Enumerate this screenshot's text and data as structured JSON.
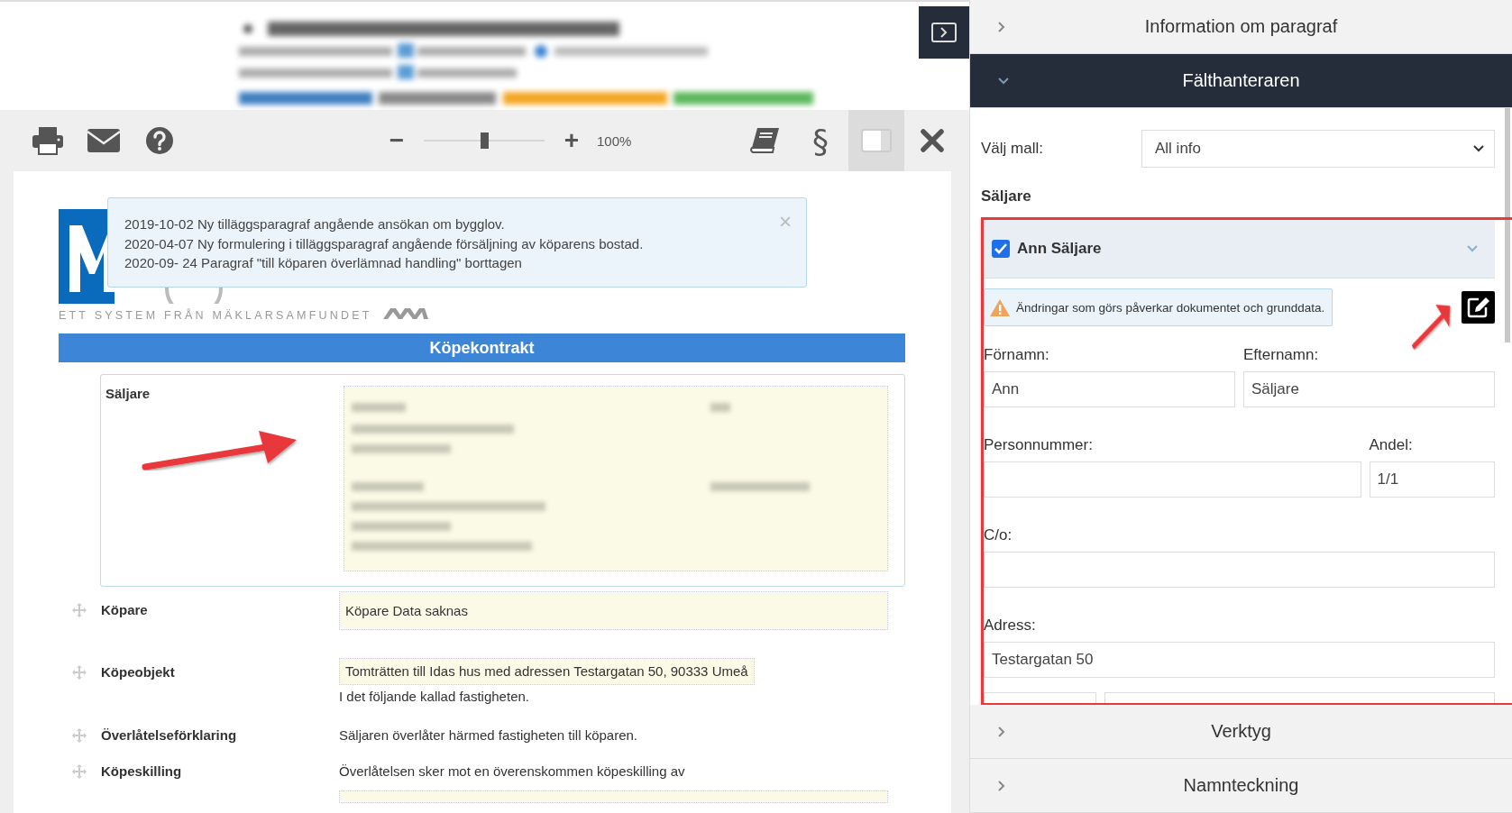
{
  "toolbar": {
    "left": [
      {
        "kind": "print"
      },
      {
        "kind": "mail"
      },
      {
        "kind": "help"
      }
    ],
    "zoom": {
      "minus": "−",
      "plus": "+",
      "level": 0.5,
      "reading": "100%"
    },
    "right": [
      {
        "kind": "book",
        "selected": false
      },
      {
        "kind": "text",
        "label": "§",
        "selected": false
      },
      {
        "kind": "panel",
        "selected": true
      },
      {
        "kind": "close",
        "selected": false
      }
    ]
  },
  "notification": {
    "lines": [
      "2019-10-02 Ny tilläggsparagraf angående ansökan om bygglov.",
      "2020-04-07 Ny formulering i tilläggsparagraf angående försäljning av köparens bostad.",
      "2020-09- 24 Paragraf \"till köparen överlämnad handling\" borttagen"
    ],
    "close": "×"
  },
  "logo": {
    "tagline": "ETT SYSTEM FRÅN MÄKLARSAMFUNDET"
  },
  "document": {
    "title": "Köpekontrakt",
    "sections": [
      {
        "label": "Säljare",
        "kind": "blurred",
        "selected": true
      },
      {
        "label": "Köpare",
        "kind": "field",
        "value": "Köpare Data saknas",
        "selected": false
      },
      {
        "label": "Köpeobjekt",
        "kind": "inline",
        "value": "Tomträtten till Idas hus med adressen Testargatan 50, 90333 Umeå",
        "after": "I det följande kallad fastigheten.",
        "selected": false
      },
      {
        "label": "Överlåtelseförklaring",
        "kind": "text",
        "text": "Säljaren överlåter härmed fastigheten till köparen.",
        "selected": false
      },
      {
        "label": "Köpeskilling",
        "kind": "text_field",
        "text": "Överlåtelsen sker mot en överenskommen köpeskilling av",
        "selected": false
      }
    ]
  },
  "sidebar": {
    "sections": [
      {
        "title": "Information om paragraf",
        "expanded": false
      },
      {
        "title": "Fälthanteraren",
        "expanded": true
      },
      {
        "title": "Verktyg",
        "expanded": false
      },
      {
        "title": "Namnteckning",
        "expanded": false
      }
    ],
    "template": {
      "label": "Välj mall:",
      "value": "All info"
    },
    "group_title": "Säljare",
    "person": {
      "name": "Ann Säljare",
      "checked": true,
      "expanded": true,
      "warning": "Ändringar som görs påverkar dokumentet och grunddata.",
      "rows": [
        {
          "kind": "pair",
          "fields": [
            {
              "label": "Förnamn:",
              "value": "Ann"
            },
            {
              "label": "Efternamn:",
              "value": "Säljare"
            }
          ]
        },
        {
          "kind": "main_side",
          "fields": [
            {
              "label": "Personnummer:"
            },
            {
              "label": "Andel:",
              "value": "1/1"
            }
          ]
        },
        {
          "kind": "single",
          "fields": [
            {
              "label": "C/o:"
            }
          ]
        },
        {
          "kind": "single",
          "fields": [
            {
              "label": "Adress:",
              "value": "Testargatan 50"
            }
          ]
        },
        {
          "kind": "zip_city"
        }
      ]
    }
  }
}
